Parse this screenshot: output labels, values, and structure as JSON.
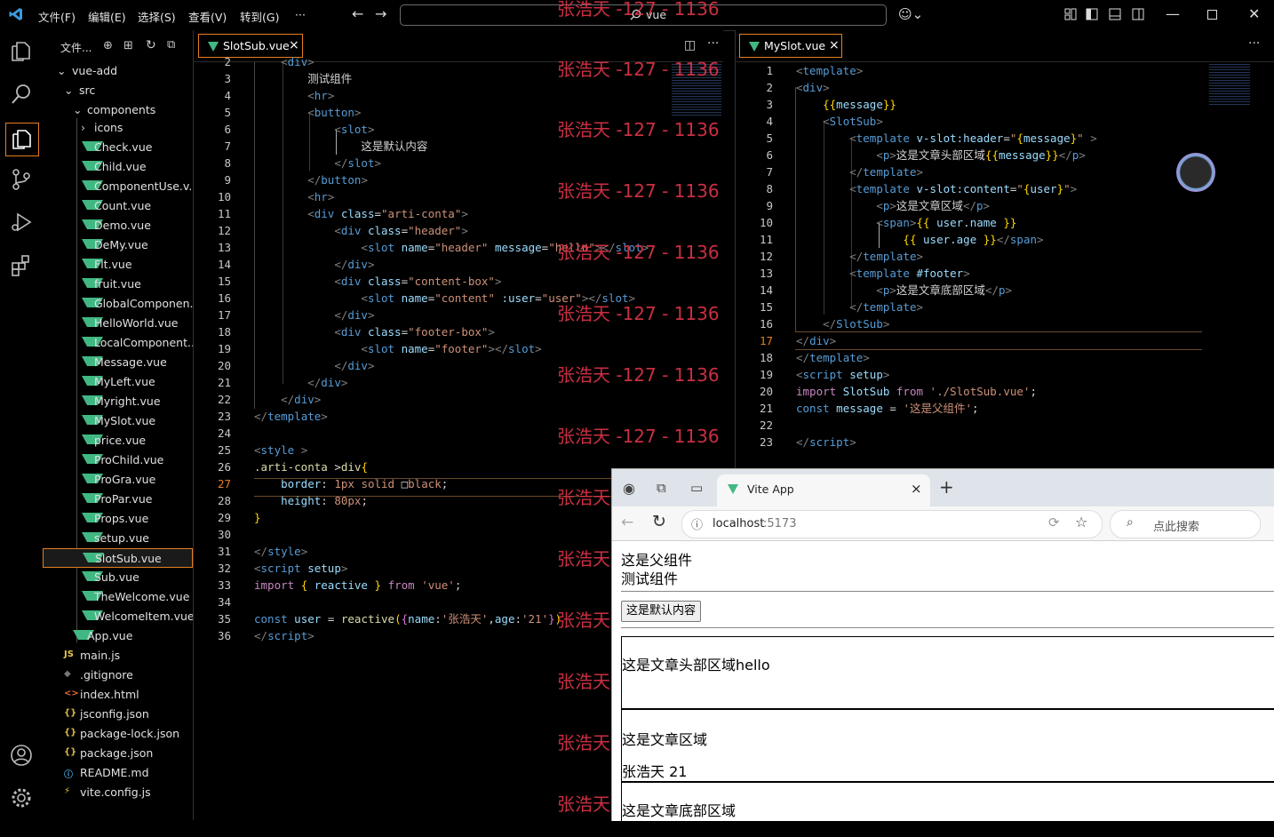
{
  "titlebar": {
    "menus": [
      "文件(F)",
      "编辑(E)",
      "选择(S)",
      "查看(V)",
      "转到(G)",
      "···"
    ],
    "search": "vue"
  },
  "explorer": {
    "header": "文件...",
    "root": "vue-add",
    "src": "src",
    "components": "components",
    "icons_folder": "icons",
    "files": [
      "Check.vue",
      "Child.vue",
      "ComponentUse.v...",
      "Count.vue",
      "Demo.vue",
      "DeMy.vue",
      "Flt.vue",
      "fruit.vue",
      "GlobalComponen...",
      "HelloWorld.vue",
      "LocalComponent...",
      "Message.vue",
      "MyLeft.vue",
      "Myright.vue",
      "MySlot.vue",
      "price.vue",
      "ProChild.vue",
      "ProGra.vue",
      "ProPar.vue",
      "Props.vue",
      "setup.vue",
      "SlotSub.vue",
      "Sub.vue",
      "TheWelcome.vue",
      "WelcomeItem.vue"
    ],
    "root_files": [
      {
        "name": "App.vue",
        "icon": "vue"
      },
      {
        "name": "main.js",
        "icon": "JS"
      },
      {
        "name": ".gitignore",
        "icon": "◆"
      },
      {
        "name": "index.html",
        "icon": "<>"
      },
      {
        "name": "jsconfig.json",
        "icon": "{}"
      },
      {
        "name": "package-lock.json",
        "icon": "{}"
      },
      {
        "name": "package.json",
        "icon": "{}"
      },
      {
        "name": "README.md",
        "icon": "ⓘ"
      },
      {
        "name": "vite.config.js",
        "icon": "⚡"
      }
    ]
  },
  "left_editor": {
    "tab": "SlotSub.vue",
    "line_numbers": [
      "2",
      "3",
      "4",
      "5",
      "6",
      "7",
      "8",
      "9",
      "10",
      "11",
      "12",
      "13",
      "14",
      "15",
      "16",
      "17",
      "18",
      "19",
      "20",
      "21",
      "22",
      "23",
      "24",
      "25",
      "26",
      "27",
      "28",
      "29",
      "30",
      "31",
      "32",
      "33",
      "34",
      "35",
      "36"
    ],
    "active_line": "27"
  },
  "right_editor": {
    "tab": "MySlot.vue",
    "line_numbers": [
      "1",
      "2",
      "3",
      "4",
      "5",
      "6",
      "7",
      "8",
      "9",
      "10",
      "11",
      "12",
      "13",
      "14",
      "15",
      "16",
      "17",
      "18",
      "19",
      "20",
      "21",
      "22",
      "23"
    ],
    "active_line": "17"
  },
  "watermark": "张浩天 -127 - 1136",
  "browser": {
    "tab_title": "Vite App",
    "url_host": "localhost",
    "url_port": ":5173",
    "search_placeholder": "点此搜索",
    "content": {
      "parent": "这是父组件",
      "test": "测试组件",
      "button": "这是默认内容",
      "header": "这是文章头部区域hello",
      "content": "这是文章区域",
      "user": "张浩天 21",
      "footer": "这是文章底部区域"
    }
  },
  "colors": {
    "accent": "#e67e22",
    "vue": "#41b883",
    "watermark": "#e0354a"
  }
}
